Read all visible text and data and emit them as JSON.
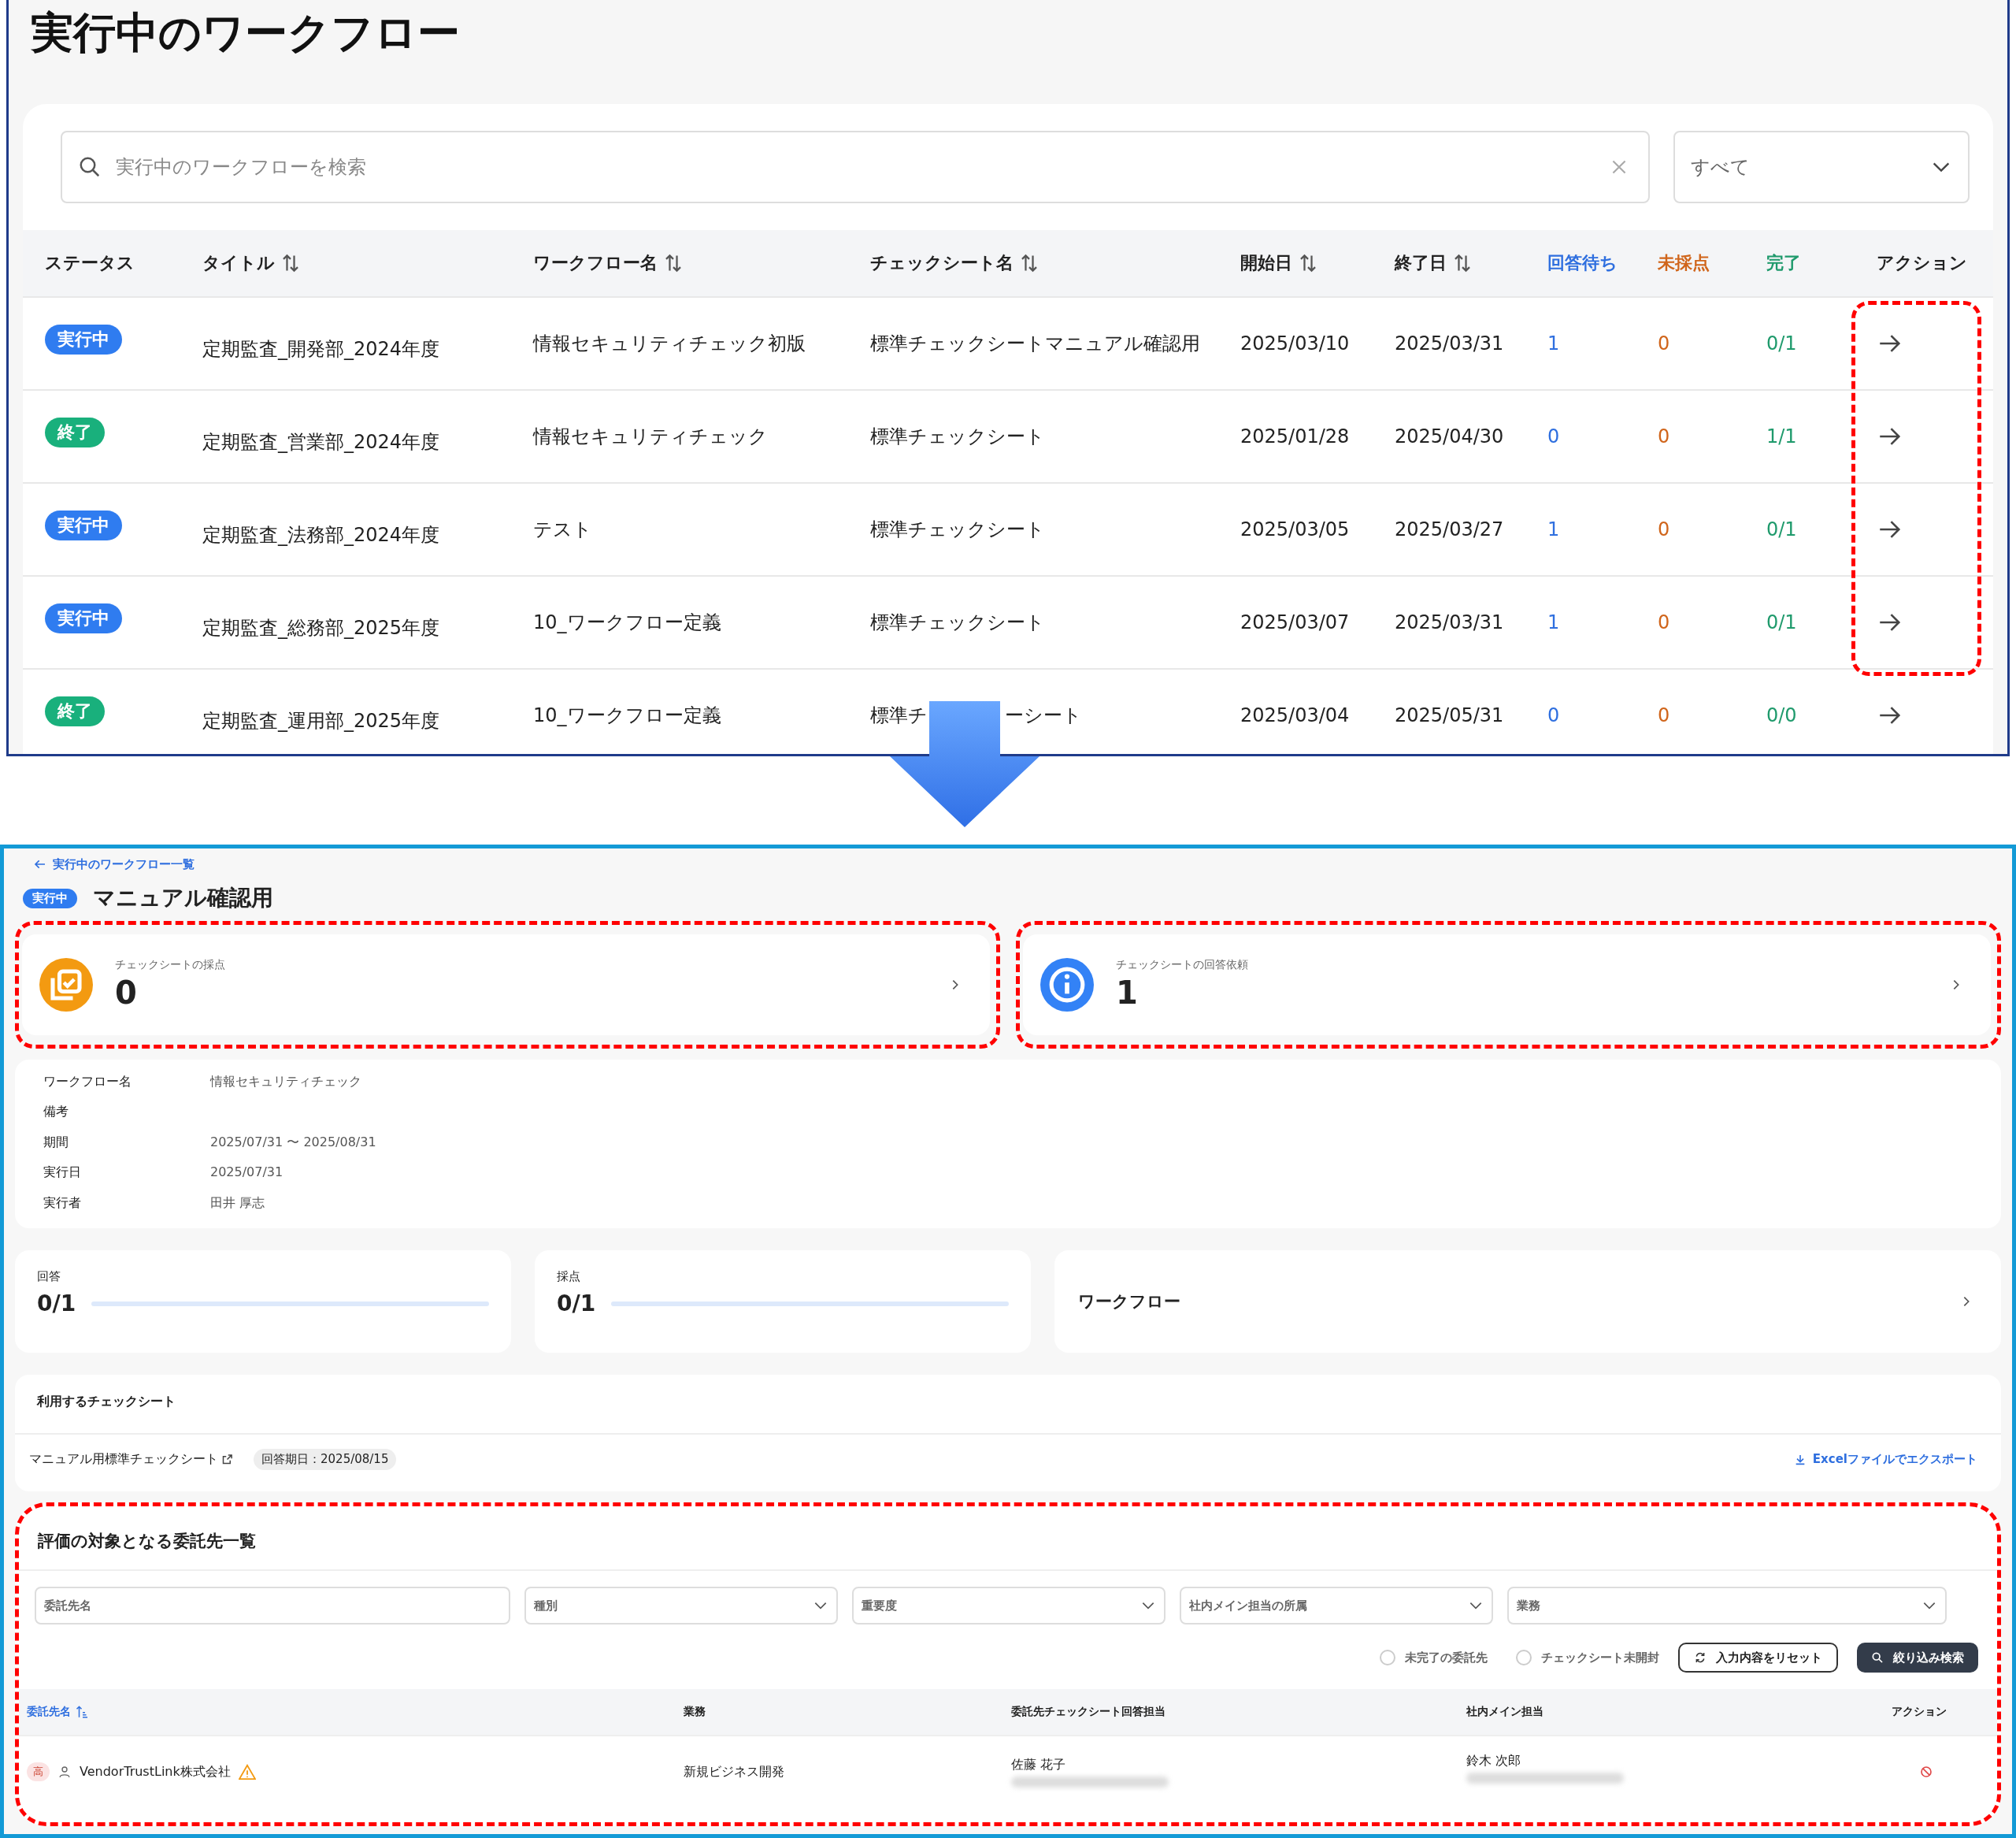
{
  "workflow_list": {
    "title": "実行中のワークフロー",
    "search": {
      "placeholder": "実行中のワークフローを検索"
    },
    "filter": {
      "value": "すべて"
    },
    "status_header": "ステータス",
    "columns": [
      {
        "label": "タイトル",
        "sortable": true
      },
      {
        "label": "ワークフロー名",
        "sortable": true
      },
      {
        "label": "チェックシート名",
        "sortable": true
      },
      {
        "label": "開始日",
        "sortable": true
      },
      {
        "label": "終了日",
        "sortable": true
      },
      {
        "label": "回答待ち",
        "sortable": false,
        "color": "#2f6fdf"
      },
      {
        "label": "未採点",
        "sortable": false,
        "color": "#d0651b"
      },
      {
        "label": "完了",
        "sortable": false,
        "color": "#1f9a6c"
      }
    ],
    "action_header": "アクション",
    "rows": [
      {
        "status": {
          "label": "実行中",
          "kind": "running"
        },
        "cells": [
          "定期監査_開発部_2024年度",
          "情報セキュリティチェック初版",
          "標準チェックシートマニュアル確認用",
          "2025/03/10",
          "2025/03/31",
          "1",
          "0",
          "0/1"
        ]
      },
      {
        "status": {
          "label": "終了",
          "kind": "done"
        },
        "cells": [
          "定期監査_営業部_2024年度",
          "情報セキュリティチェック",
          "標準チェックシート",
          "2025/01/28",
          "2025/04/30",
          "0",
          "0",
          "1/1"
        ]
      },
      {
        "status": {
          "label": "実行中",
          "kind": "running"
        },
        "cells": [
          "定期監査_法務部_2024年度",
          "テスト",
          "標準チェックシート",
          "2025/03/05",
          "2025/03/27",
          "1",
          "0",
          "0/1"
        ]
      },
      {
        "status": {
          "label": "実行中",
          "kind": "running"
        },
        "cells": [
          "定期監査_総務部_2025年度",
          "10_ワークフロー定義",
          "標準チェックシート",
          "2025/03/07",
          "2025/03/31",
          "1",
          "0",
          "0/1"
        ]
      },
      {
        "status": {
          "label": "終了",
          "kind": "done"
        },
        "cells": [
          "定期監査_運用部_2025年度",
          "10_ワークフロー定義",
          "標準チ",
          "2025/03/04",
          "2025/05/31",
          "0",
          "0",
          "0/0"
        ],
        "cells_after_cover": "ーシート"
      }
    ]
  },
  "detail": {
    "back_link": "実行中のワークフロー一覧",
    "status": {
      "label": "実行中",
      "kind": "running"
    },
    "title": "マニュアル確認用",
    "summary_cards": [
      {
        "kind": "scoring",
        "label": "チェックシートの採点",
        "value": "0"
      },
      {
        "kind": "request",
        "label": "チェックシートの回答依頼",
        "value": "1"
      }
    ],
    "info": [
      {
        "label": "ワークフロー名",
        "value": "情報セキュリティチェック"
      },
      {
        "label": "備考"
      },
      {
        "label": "期間",
        "value": "2025/07/31 〜 2025/08/31"
      },
      {
        "label": "実行日",
        "value": "2025/07/31"
      },
      {
        "label": "実行者",
        "value": "田井 厚志"
      }
    ],
    "progress": [
      {
        "label": "回答",
        "reading": "0/1",
        "level": 0
      },
      {
        "label": "採点",
        "reading": "0/1",
        "level": 0
      }
    ],
    "workflow_link": "ワークフロー",
    "checksheets": {
      "title": "利用するチェックシート",
      "name": "マニュアル用標準チェックシート",
      "due": "回答期日：2025/08/15",
      "export": "Excelファイルでエクスポート"
    },
    "vendors": {
      "title": "評価の対象となる委託先一覧",
      "filters": [
        {
          "placeholder": "委託先名",
          "kind": "text"
        },
        {
          "placeholder": "種別",
          "kind": "select"
        },
        {
          "placeholder": "重要度",
          "kind": "select"
        },
        {
          "placeholder": "社内メイン担当の所属",
          "kind": "select"
        },
        {
          "placeholder": "業務",
          "kind": "select"
        }
      ],
      "checkboxes": [
        {
          "label": "未完了の委託先",
          "checked": false
        },
        {
          "label": "チェックシート未開封",
          "checked": false
        }
      ],
      "reset_button": "入力内容をリセット",
      "search_button": "絞り込み検索",
      "columns": [
        {
          "label": "委託先名",
          "sorted": true
        },
        {
          "label": "業務",
          "sorted": false
        },
        {
          "label": "委託先チェックシート回答担当",
          "sorted": false
        },
        {
          "label": "社内メイン担当",
          "sorted": false
        },
        {
          "label": "アクション",
          "sorted": false
        }
      ],
      "rows": [
        {
          "priority": "高",
          "name": "VendorTrustLink株式会社",
          "warning": true,
          "business": "新規ビジネス開発",
          "respondent": "佐藤 花子",
          "owner": "鈴木 次郎"
        }
      ]
    }
  }
}
